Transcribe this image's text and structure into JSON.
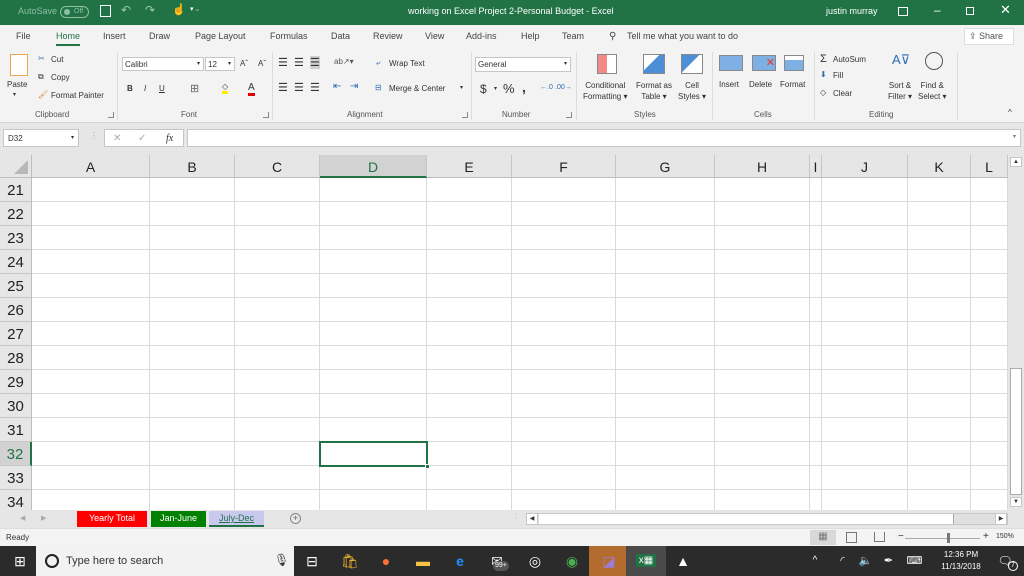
{
  "titlebar": {
    "autosave_label": "AutoSave",
    "autosave_state": "Off",
    "document_title": "working on  Excel Project 2-Personal Budget  -  Excel",
    "user": "justin murray"
  },
  "ribbon_tabs": [
    "File",
    "Home",
    "Insert",
    "Draw",
    "Page Layout",
    "Formulas",
    "Data",
    "Review",
    "View",
    "Add-ins",
    "Help",
    "Team"
  ],
  "active_tab": "Home",
  "tell_me": "Tell me what you want to do",
  "share_label": "Share",
  "clipboard": {
    "paste": "Paste",
    "cut": "Cut",
    "copy": "Copy",
    "format_painter": "Format Painter",
    "group": "Clipboard"
  },
  "font": {
    "name": "Calibri",
    "size": "12",
    "group": "Font",
    "bold": "B",
    "italic": "I",
    "underline": "U",
    "grow": "Aˆ",
    "shrink": "Aˇ",
    "font_color": "A"
  },
  "alignment": {
    "wrap_text": "Wrap Text",
    "merge_center": "Merge & Center",
    "group": "Alignment"
  },
  "number": {
    "format": "General",
    "currency": "$",
    "percent": "%",
    "comma": ",",
    "group": "Number"
  },
  "styles": {
    "conditional": [
      "Conditional",
      "Formatting"
    ],
    "format_table": [
      "Format as",
      "Table"
    ],
    "cell_styles": [
      "Cell",
      "Styles"
    ],
    "group": "Styles"
  },
  "cells": {
    "insert": "Insert",
    "delete": "Delete",
    "format": "Format",
    "group": "Cells"
  },
  "editing": {
    "autosum": "AutoSum",
    "fill": "Fill",
    "clear": "Clear",
    "sort_filter": [
      "Sort &",
      "Filter"
    ],
    "find_select": [
      "Find &",
      "Select"
    ],
    "group": "Editing"
  },
  "formula_bar": {
    "name_box": "D32",
    "fx": "fx",
    "formula": ""
  },
  "columns": [
    "A",
    "B",
    "C",
    "D",
    "E",
    "F",
    "G",
    "H",
    "I",
    "J",
    "K",
    "L"
  ],
  "selected_column": "D",
  "rows": [
    "21",
    "22",
    "23",
    "24",
    "25",
    "26",
    "27",
    "28",
    "29",
    "30",
    "31",
    "32",
    "33",
    "34"
  ],
  "selected_row": "32",
  "sheets": [
    {
      "name": "Yearly Total",
      "color": "#ff0000",
      "text": "#ffffff"
    },
    {
      "name": "Jan-June",
      "color": "#008000",
      "text": "#ffffff"
    },
    {
      "name": "July-Dec",
      "color": "#c9c9f0",
      "text": "#217346",
      "active": true
    }
  ],
  "status": {
    "ready": "Ready",
    "zoom": "150%"
  },
  "taskbar": {
    "search_placeholder": "Type here to search",
    "time": "12:36 PM",
    "date": "11/13/2018",
    "notifications": "7",
    "badge": "99+"
  },
  "colors": {
    "accent": "#217346"
  }
}
